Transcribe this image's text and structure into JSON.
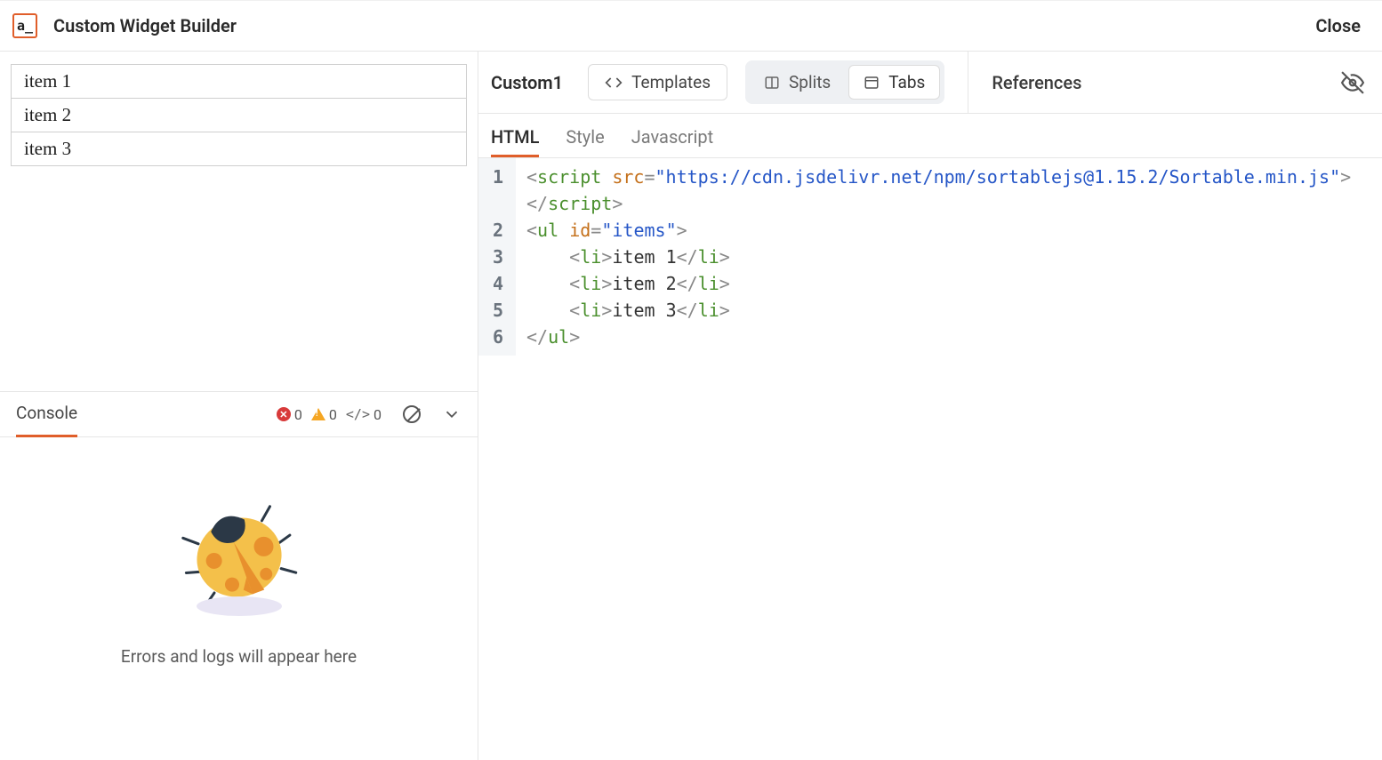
{
  "header": {
    "logo_text": "a_",
    "title": "Custom Widget Builder",
    "close_label": "Close"
  },
  "preview": {
    "items": [
      "item 1",
      "item 2",
      "item 3"
    ]
  },
  "console": {
    "tab_label": "Console",
    "errors_count": "0",
    "warnings_count": "0",
    "logs_count": "0",
    "empty_message": "Errors and logs will appear here"
  },
  "right_header": {
    "widget_name": "Custom1",
    "templates_label": "Templates",
    "splits_label": "Splits",
    "tabs_label": "Tabs",
    "references_label": "References"
  },
  "code_tabs": {
    "html": "HTML",
    "style": "Style",
    "javascript": "Javascript"
  },
  "editor": {
    "line_numbers": [
      "1",
      "2",
      "3",
      "4",
      "5",
      "6"
    ],
    "tokens": {
      "script_open": "script",
      "src_attr": "src",
      "src_val": "\"https://cdn.jsdelivr.net/npm/sortablejs@1.15.2/Sortable.min.js\"",
      "script_close": "script",
      "ul_open": "ul",
      "id_attr": "id",
      "id_val": "\"items\"",
      "li": "li",
      "li1_text": "item 1",
      "li2_text": "item 2",
      "li3_text": "item 3",
      "ul_close": "ul"
    }
  }
}
